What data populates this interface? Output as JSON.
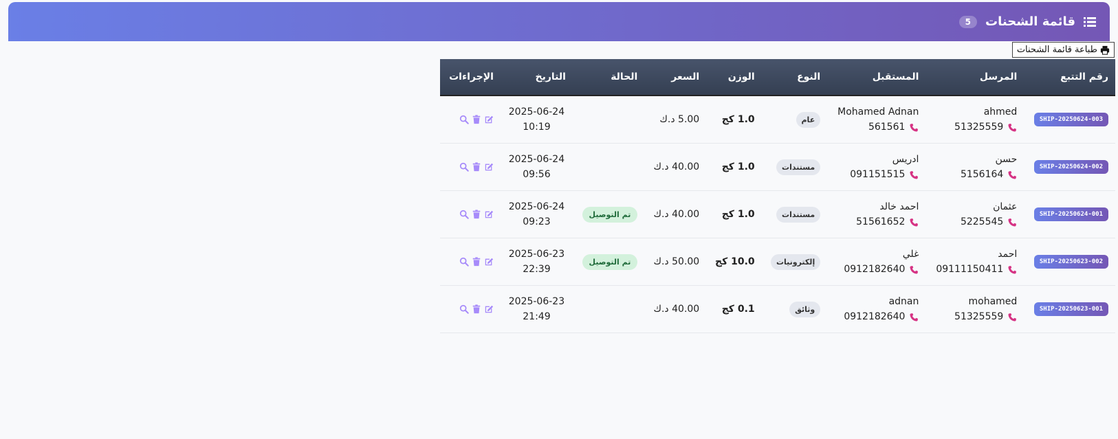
{
  "header": {
    "title": "قائمة الشحنات",
    "count": "5",
    "icon": "list-icon"
  },
  "print_button": {
    "label": "طباعة قائمة الشحنات",
    "icon": "printer-icon"
  },
  "table": {
    "columns": {
      "tracking": "رقم التتبع",
      "sender": "المرسل",
      "receiver": "المستقبل",
      "type": "النوع",
      "weight": "الوزن",
      "price": "السعر",
      "status": "الحالة",
      "date": "التاريخ",
      "actions": "الإجراءات"
    },
    "rows": [
      {
        "tracking": "SHIP-20250624-003",
        "sender_name": "ahmed",
        "sender_phone": "51325559",
        "receiver_name": "Mohamed Adnan",
        "receiver_phone": "561561",
        "type": "عام",
        "weight": "1.0 كج",
        "price": "5.00 د.ك",
        "status": "",
        "date": "2025-06-24",
        "time": "10:19"
      },
      {
        "tracking": "SHIP-20250624-002",
        "sender_name": "حسن",
        "sender_phone": "5156164",
        "receiver_name": "ادريس",
        "receiver_phone": "091151515",
        "type": "مستندات",
        "weight": "1.0 كج",
        "price": "40.00 د.ك",
        "status": "",
        "date": "2025-06-24",
        "time": "09:56"
      },
      {
        "tracking": "SHIP-20250624-001",
        "sender_name": "عثمان",
        "sender_phone": "5225545",
        "receiver_name": "احمد خالد",
        "receiver_phone": "51561652",
        "type": "مستندات",
        "weight": "1.0 كج",
        "price": "40.00 د.ك",
        "status": "تم التوصيل",
        "date": "2025-06-24",
        "time": "09:23"
      },
      {
        "tracking": "SHIP-20250623-002",
        "sender_name": "احمد",
        "sender_phone": "09111150411",
        "receiver_name": "غلي",
        "receiver_phone": "0912182640",
        "type": "إلكترونيات",
        "weight": "10.0 كج",
        "price": "50.00 د.ك",
        "status": "تم التوصيل",
        "date": "2025-06-23",
        "time": "22:39"
      },
      {
        "tracking": "SHIP-20250623-001",
        "sender_name": "mohamed",
        "sender_phone": "51325559",
        "receiver_name": "adnan",
        "receiver_phone": "0912182640",
        "type": "وثائق",
        "weight": "0.1 كج",
        "price": "40.00 د.ك",
        "status": "",
        "date": "2025-06-23",
        "time": "21:49"
      }
    ]
  },
  "colors": {
    "header_gradient_start": "#6a7fe6",
    "header_gradient_end": "#7457b5",
    "table_header": "#3d4759",
    "phone_icon": "#d63384",
    "action_icon": "#a78bfa",
    "status_bg": "#d3f1dc"
  },
  "icons": {
    "phone": "phone-icon",
    "view": "search-icon",
    "delete": "trash-icon",
    "edit": "edit-icon"
  }
}
